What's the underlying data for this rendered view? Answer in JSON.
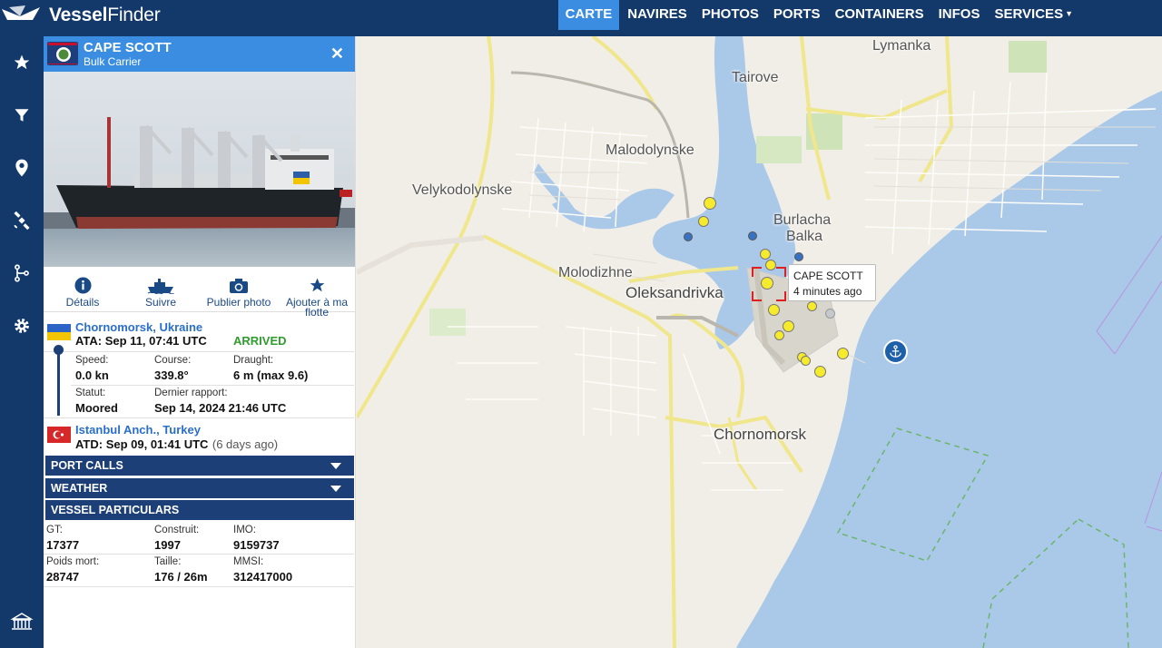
{
  "header": {
    "brand_strong": "Vessel",
    "brand_light": "Finder",
    "nav": [
      {
        "label": "CARTE",
        "active": true
      },
      {
        "label": "NAVIRES"
      },
      {
        "label": "PHOTOS"
      },
      {
        "label": "PORTS"
      },
      {
        "label": "CONTAINERS"
      },
      {
        "label": "INFOS"
      },
      {
        "label": "SERVICES"
      }
    ],
    "accent_color": "#3a8de0",
    "bar_color": "#13396b"
  },
  "sidebar": {
    "icons": [
      "star-icon",
      "filter-icon",
      "map-pin-icon",
      "satellite-icon",
      "route-icon",
      "gear-icon",
      "port-icon"
    ]
  },
  "vessel": {
    "name": "CAPE SCOTT",
    "type": "Bulk Carrier",
    "actions": [
      {
        "label": "Détails",
        "icon": "info-icon"
      },
      {
        "label": "Suivre",
        "icon": "ship-icon"
      },
      {
        "label": "Publier photo",
        "icon": "camera-icon"
      },
      {
        "label": "Ajouter à ma flotte",
        "icon": "star-icon"
      }
    ],
    "destination": {
      "port": "Chornomorsk, Ukraine",
      "ata": "ATA: Sep 11, 07:41 UTC",
      "status": "ARRIVED",
      "status_color": "#2e9d2e"
    },
    "speed_label": "Speed:",
    "speed": "0.0 kn",
    "course_label": "Course:",
    "course": "339.8°",
    "draught_label": "Draught:",
    "draught": "6 m (max 9.6)",
    "statut_label": "Statut:",
    "statut": "Moored",
    "report_label": "Dernier rapport:",
    "report": "Sep 14, 2024 21:46 UTC",
    "origin": {
      "port": "Istanbul Anch., Turkey",
      "atd": "ATD: Sep 09, 01:41 UTC",
      "ago": "(6 days ago)"
    },
    "sections": [
      "PORT CALLS",
      "WEATHER",
      "VESSEL PARTICULARS"
    ],
    "particulars": {
      "gt_label": "GT:",
      "gt": "17377",
      "built_label": "Construit:",
      "built": "1997",
      "imo_label": "IMO:",
      "imo": "9159737",
      "dwt_label": "Poids mort:",
      "dwt": "28747",
      "size_label": "Taille:",
      "size": "176 / 26m",
      "mmsi_label": "MMSI:",
      "mmsi": "312417000"
    }
  },
  "map": {
    "places": [
      "Lymanka",
      "Tairove",
      "Malodolynske",
      "Velykodolynske",
      "Burlacha",
      "Balka",
      "Molodizhne",
      "Oleksandrivka",
      "Chornomorsk"
    ],
    "tooltip_name": "CAPE SCOTT",
    "tooltip_time": "4 minutes ago"
  }
}
